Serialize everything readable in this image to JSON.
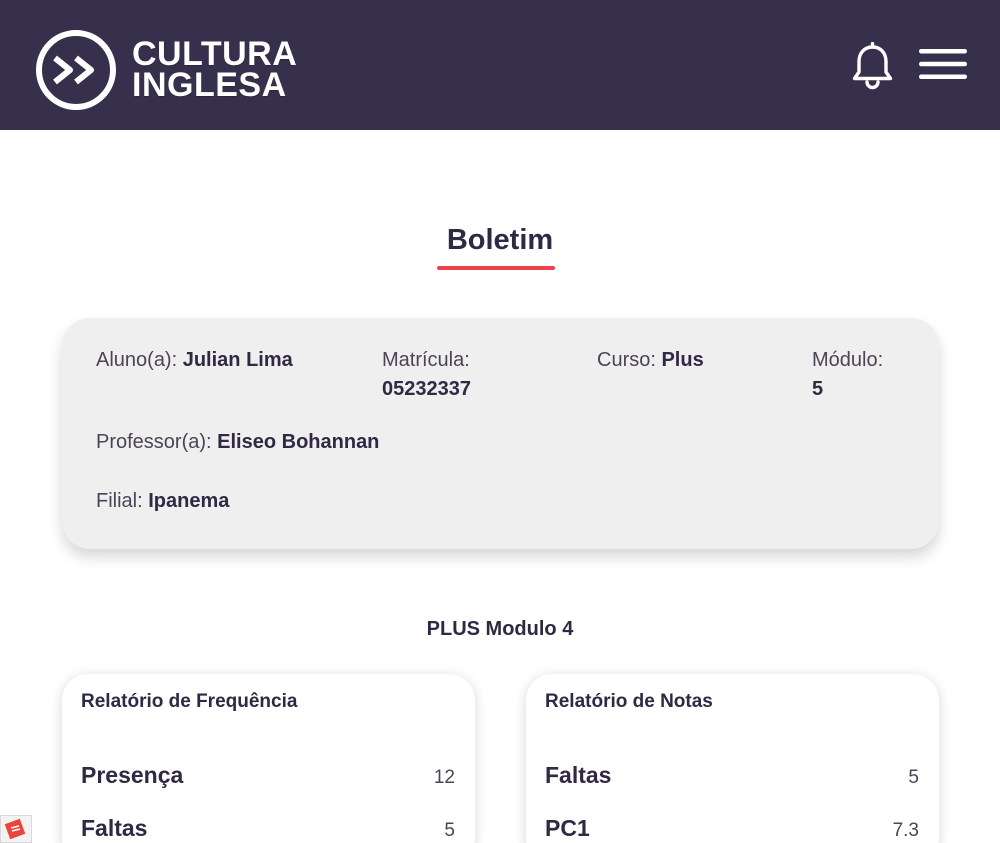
{
  "header": {
    "logo_line1": "CULTURA",
    "logo_line2": "INGLESA",
    "bell_icon": "bell-icon",
    "menu_icon": "hamburger-menu-icon",
    "bg_color": "#37304d"
  },
  "page": {
    "title": "Boletim",
    "accent_color": "#f0414a"
  },
  "student": {
    "aluno_label": "Aluno(a):",
    "aluno_value": "Julian Lima",
    "matricula_label": "Matrícula:",
    "matricula_value": "05232337",
    "curso_label": "Curso:",
    "curso_value": "Plus",
    "modulo_label": "Módulo:",
    "modulo_value": "5",
    "professor_label": "Professor(a):",
    "professor_value": "Eliseo Bohannan",
    "filial_label": "Filial:",
    "filial_value": "Ipanema"
  },
  "section": {
    "title": "PLUS Modulo 4"
  },
  "frequencia": {
    "title": "Relatório de Frequência",
    "rows": [
      {
        "label": "Presença",
        "value": "12"
      },
      {
        "label": "Faltas",
        "value": "5"
      }
    ]
  },
  "notas": {
    "title": "Relatório de Notas",
    "rows": [
      {
        "label": "Faltas",
        "value": "5"
      },
      {
        "label": "PC1",
        "value": "7.3"
      }
    ]
  }
}
